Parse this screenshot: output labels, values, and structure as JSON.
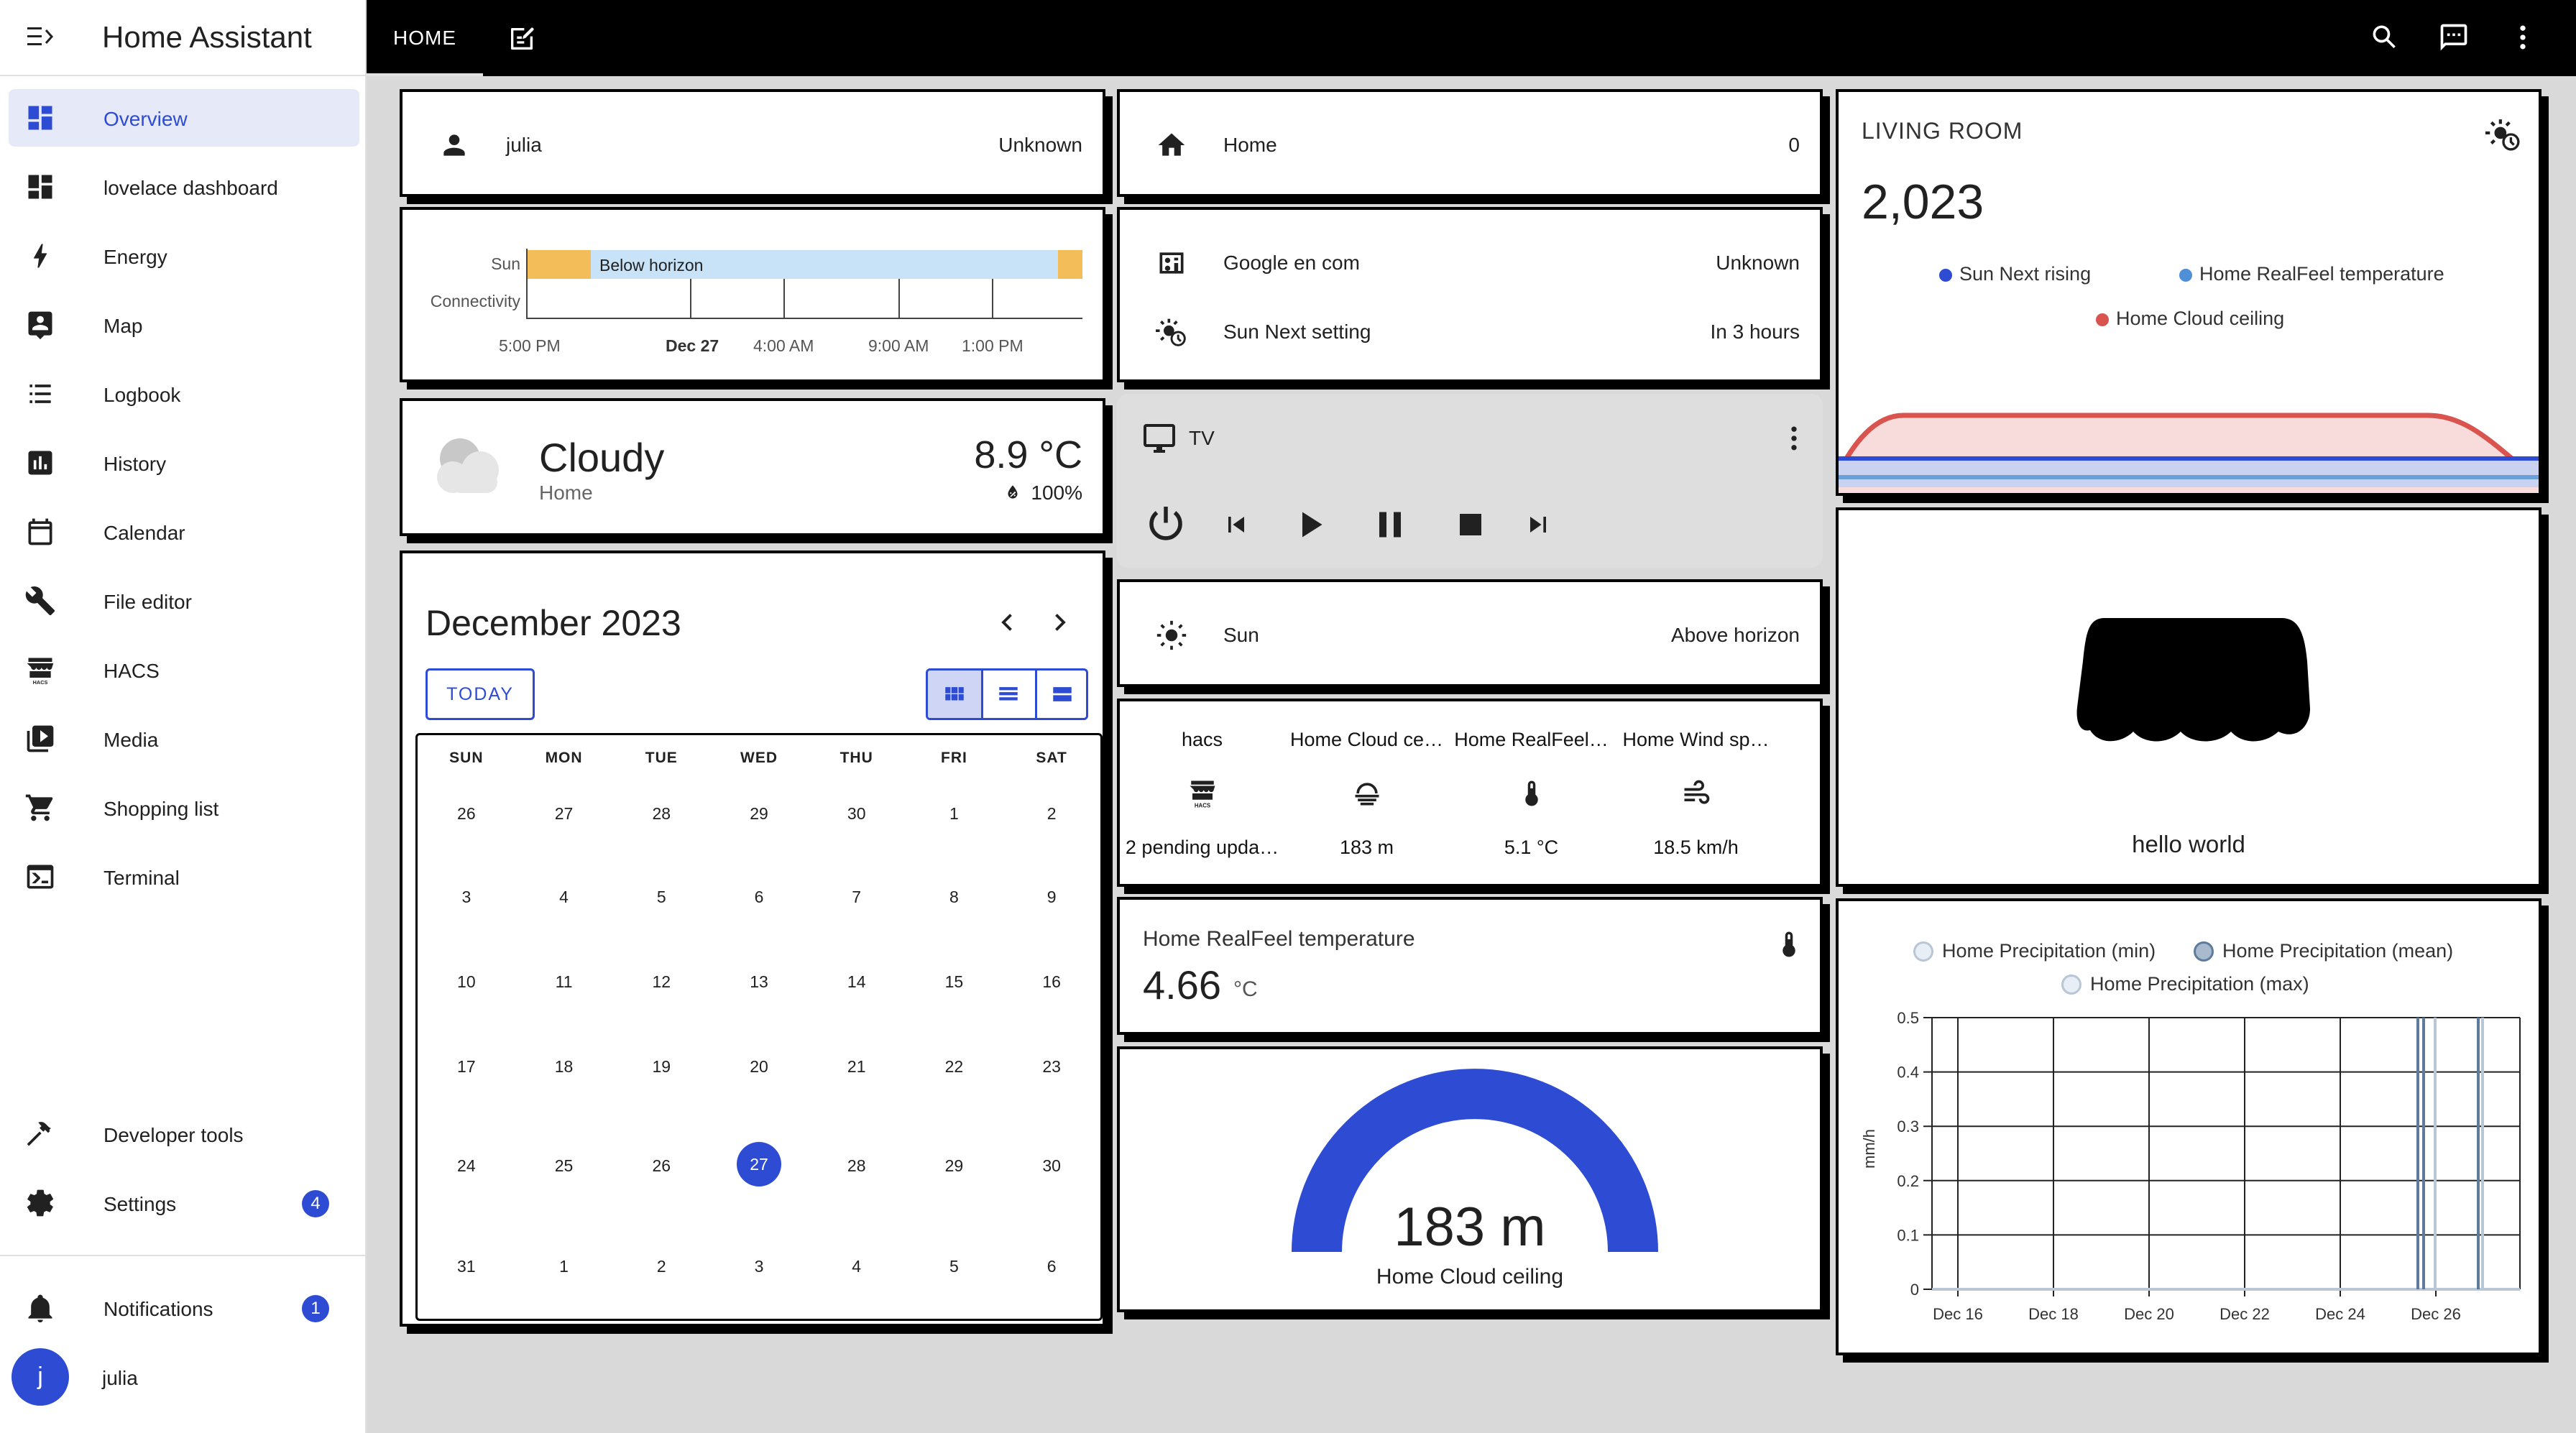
{
  "app": {
    "title": "Home Assistant"
  },
  "sidebar": {
    "items": [
      {
        "label": "Overview",
        "icon": "view-dashboard-icon"
      },
      {
        "label": "lovelace dashboard",
        "icon": "view-dashboard-icon"
      },
      {
        "label": "Energy",
        "icon": "lightning-bolt-icon"
      },
      {
        "label": "Map",
        "icon": "account-box-icon"
      },
      {
        "label": "Logbook",
        "icon": "format-list-bulleted-icon"
      },
      {
        "label": "History",
        "icon": "chart-box-icon"
      },
      {
        "label": "Calendar",
        "icon": "calendar-icon"
      },
      {
        "label": "File editor",
        "icon": "wrench-icon"
      },
      {
        "label": "HACS",
        "icon": "hacs-icon"
      },
      {
        "label": "Media",
        "icon": "play-box-multiple-icon"
      },
      {
        "label": "Shopping list",
        "icon": "cart-icon"
      },
      {
        "label": "Terminal",
        "icon": "console-icon"
      }
    ],
    "developer_tools": "Developer tools",
    "settings": {
      "label": "Settings",
      "badge": "4"
    },
    "notifications": {
      "label": "Notifications",
      "badge": "1"
    },
    "user": {
      "name": "julia",
      "initial": "j"
    }
  },
  "topbar": {
    "tab_home": "HOME"
  },
  "cards": {
    "person": {
      "name": "julia",
      "state": "Unknown"
    },
    "history": {
      "rows": [
        "Sun",
        "Connectivity"
      ],
      "segment_label": "Below horizon",
      "ticks": [
        "5:00 PM",
        "Dec 27",
        "4:00 AM",
        "9:00 AM",
        "1:00 PM"
      ]
    },
    "weather": {
      "condition": "Cloudy",
      "location": "Home",
      "temperature": "8.9 °C",
      "humidity": "100%"
    },
    "calendar": {
      "title": "December 2023",
      "today_button": "TODAY",
      "weekdays": [
        "SUN",
        "MON",
        "TUE",
        "WED",
        "THU",
        "FRI",
        "SAT"
      ],
      "weeks": [
        [
          "26",
          "27",
          "28",
          "29",
          "30",
          "1",
          "2"
        ],
        [
          "3",
          "4",
          "5",
          "6",
          "7",
          "8",
          "9"
        ],
        [
          "10",
          "11",
          "12",
          "13",
          "14",
          "15",
          "16"
        ],
        [
          "17",
          "18",
          "19",
          "20",
          "21",
          "22",
          "23"
        ],
        [
          "24",
          "25",
          "26",
          "27",
          "28",
          "29",
          "30"
        ],
        [
          "31",
          "1",
          "2",
          "3",
          "4",
          "5",
          "6"
        ]
      ],
      "today": "27"
    },
    "home_zone": {
      "name": "Home",
      "state": "0"
    },
    "entities": [
      {
        "name": "Google en com",
        "state": "Unknown"
      },
      {
        "name": "Sun Next setting",
        "state": "In 3 hours"
      }
    ],
    "media": {
      "name": "TV"
    },
    "sun": {
      "name": "Sun",
      "state": "Above horizon"
    },
    "glance": [
      {
        "name": "hacs",
        "state": "2 pending upda…"
      },
      {
        "name": "Home Cloud ce…",
        "state": "183 m"
      },
      {
        "name": "Home RealFeel…",
        "state": "5.1 °C"
      },
      {
        "name": "Home Wind sp…",
        "state": "18.5 km/h"
      }
    ],
    "sensor": {
      "name": "Home RealFeel temperature",
      "value": "4.66",
      "unit": "°C"
    },
    "gauge": {
      "value": "183 m",
      "name": "Home Cloud ceiling",
      "fill_fraction": 1.0,
      "color": "#2d4cd3"
    },
    "living_room": {
      "title": "LIVING ROOM",
      "value": "2,023",
      "legend": [
        {
          "label": "Sun Next rising",
          "color": "#2d4cd3"
        },
        {
          "label": "Home RealFeel temperature",
          "color": "#4e8fd8"
        },
        {
          "label": "Home Cloud ceiling",
          "color": "#d9534f"
        }
      ]
    },
    "picture": {
      "caption": "hello world"
    },
    "precip": {
      "legend": [
        "Home Precipitation (min)",
        "Home Precipitation (mean)",
        "Home Precipitation (max)"
      ],
      "ylabel": "mm/h",
      "yticks": [
        "0.5",
        "0.4",
        "0.3",
        "0.2",
        "0.1",
        "0"
      ],
      "xticks": [
        "Dec 16",
        "Dec 18",
        "Dec 20",
        "Dec 22",
        "Dec 24",
        "Dec 26"
      ]
    }
  },
  "chart_data": {
    "type": "line",
    "series": [
      {
        "name": "Home Precipitation (min)",
        "values": [
          0,
          0,
          0,
          0,
          0,
          0,
          0
        ]
      },
      {
        "name": "Home Precipitation (mean)",
        "values": [
          0,
          0,
          0,
          0,
          0,
          0,
          0
        ]
      },
      {
        "name": "Home Precipitation (max)",
        "values": [
          0,
          0,
          0,
          0,
          0,
          0,
          0
        ]
      }
    ],
    "x": [
      "Dec 16",
      "Dec 18",
      "Dec 20",
      "Dec 22",
      "Dec 24",
      "Dec 26"
    ],
    "ylabel": "mm/h",
    "ylim": [
      0,
      0.5
    ],
    "grid": true,
    "legend_position": "top"
  },
  "colors": {
    "accent": "#2d4cd3",
    "sun_above": "#f3be5a",
    "sun_below": "#c8e2f8"
  }
}
